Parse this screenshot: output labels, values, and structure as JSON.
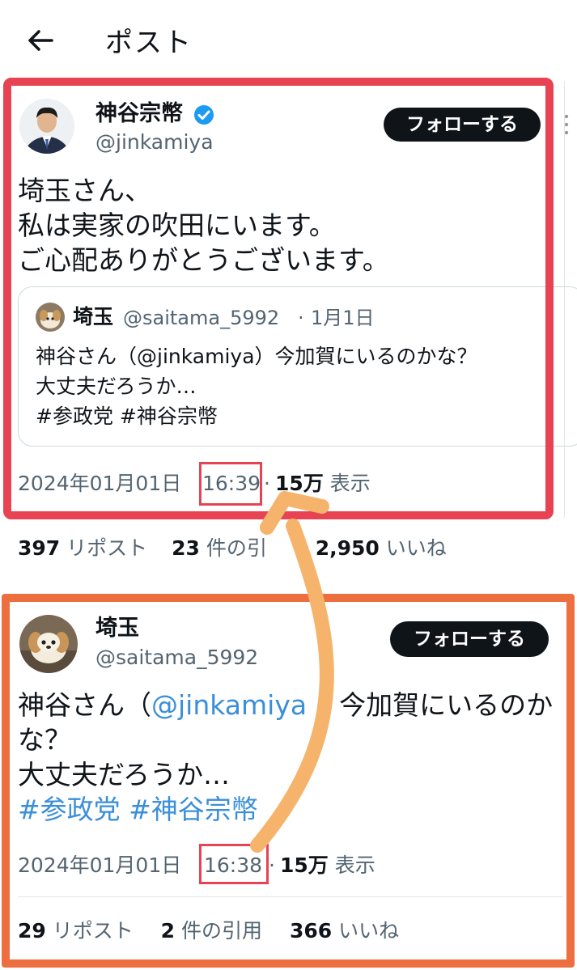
{
  "header": {
    "title": "ポスト",
    "back_icon": "arrow-left-icon"
  },
  "main_post": {
    "author_name": "神谷宗幣",
    "verified_icon": "verified-badge-icon",
    "handle": "@jinkamiya",
    "follow_label": "フォローする",
    "text_lines": [
      "埼玉さん、",
      "私は実家の吹田にいます。",
      "ご心配ありがとうございます。"
    ],
    "quote": {
      "author_name": "埼玉",
      "handle": "@saitama_5992",
      "dot": "·",
      "date": "1月1日",
      "line1_prefix": "神谷さん（",
      "line1_mention": "@jinkamiya",
      "line1_suffix": "）今加賀にいるのかな？",
      "line2": "大丈夫だろうか…",
      "line3": "#参政党 #神谷宗幣"
    },
    "date": "2024年01月01日",
    "time": "16:39",
    "dot": "·",
    "views_count": "15万",
    "views_label": "表示",
    "stats": {
      "reposts_count": "397",
      "reposts_label": "リポスト",
      "quotes_count": "23",
      "quotes_label": "件の引",
      "likes_count": "2,950",
      "likes_label": "いいね"
    }
  },
  "second_post": {
    "author_name": "埼玉",
    "handle": "@saitama_5992",
    "follow_label": "フォローする",
    "line1_prefix": "神谷さん（",
    "line1_mention": "@jinkamiya",
    "line1_suffix": "今加賀にいるのか",
    "line2": "な？",
    "line3": "大丈夫だろうか…",
    "hashtag1": "#参政党",
    "hashtag2": "#神谷宗幣",
    "date": "2024年01月01日",
    "time": "16:38",
    "dot": "·",
    "views_count": "15万",
    "views_label": "表示",
    "stats": {
      "reposts_count": "29",
      "reposts_label": "リポスト",
      "quotes_count": "2",
      "quotes_label": "件の引用",
      "likes_count": "366",
      "likes_label": "いいね"
    }
  },
  "colors": {
    "highlight_red": "#e84352",
    "highlight_orange": "#ed6e3f",
    "arrow_color": "#f5b36b",
    "link_blue": "#3a8fd8",
    "verified_blue": "#1d9bf0"
  }
}
